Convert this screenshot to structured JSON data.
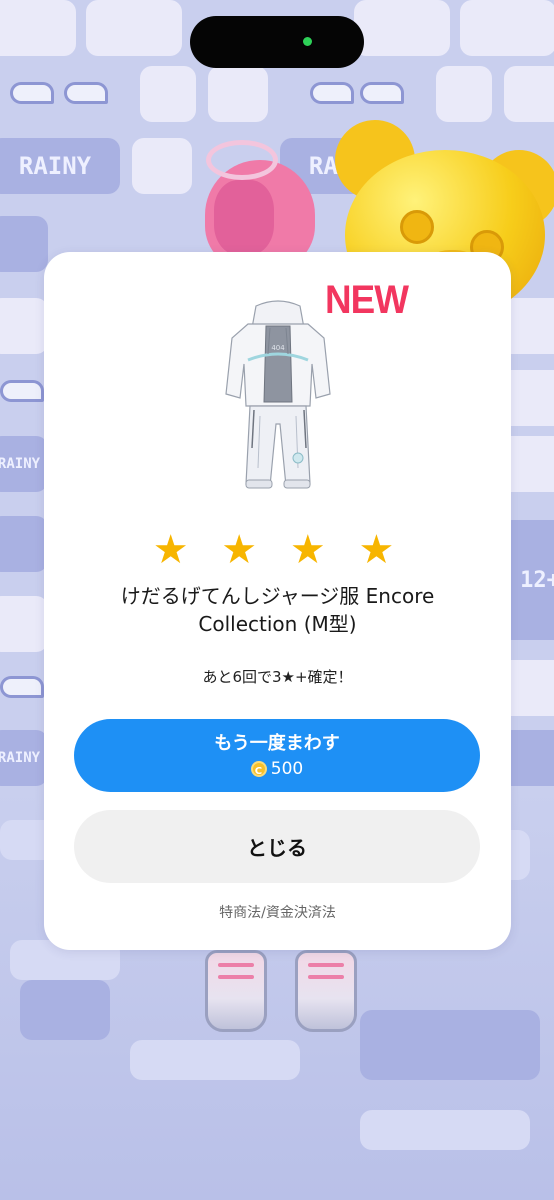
{
  "modal": {
    "new_badge": "NEW",
    "star_count": 4,
    "stars": [
      "★",
      "★",
      "★",
      "★"
    ],
    "item_name": "けだるげてんしジャージ服 Encore Collection (M型)",
    "guarantee_text": "あと6回で3★+確定！",
    "spin_again_button": {
      "label": "もう一度まわす",
      "cost": "500",
      "currency_icon": "coin-icon"
    },
    "close_button": {
      "label": "とじる"
    },
    "legal_link": "特商法/資金決済法"
  },
  "background": {
    "tile_glyphs": [
      "RAINY",
      "12+"
    ]
  },
  "colors": {
    "accent_blue": "#1e90f5",
    "star_yellow": "#f7b500",
    "new_red": "#f2365f",
    "close_button_gray": "#f0f0f0",
    "background_lavender": "#c9cfee",
    "status_dot_green": "#2ed158"
  }
}
